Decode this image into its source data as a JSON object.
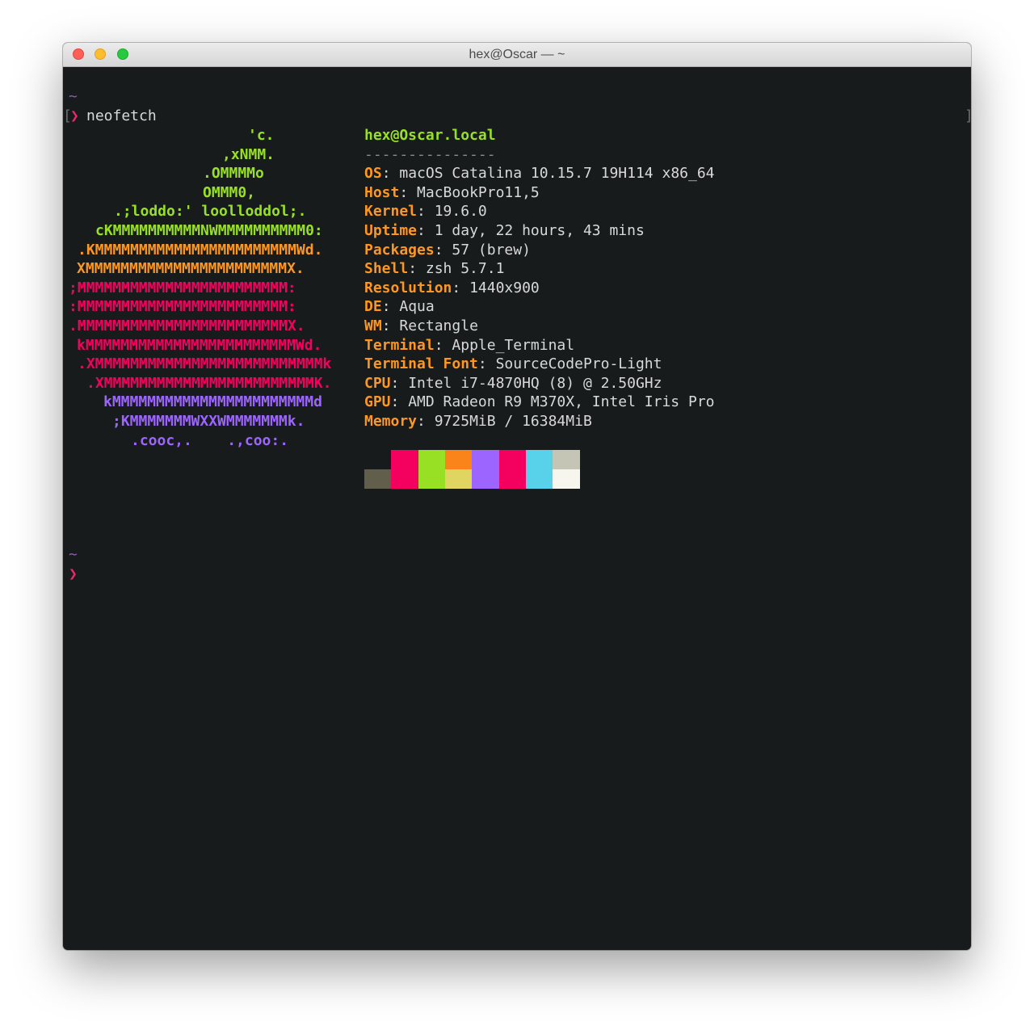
{
  "window": {
    "title": "hex@Oscar — ~"
  },
  "terminal": {
    "pre_prompt_tilde": "~",
    "left_bracket": "[",
    "right_bracket": "]",
    "prompt_symbol": "❯",
    "command": "neofetch",
    "bottom_tilde": "~",
    "bottom_prompt": "❯"
  },
  "logo": [
    {
      "text": "'c.",
      "color": "#98e024"
    },
    {
      "text": ",xNMM.",
      "color": "#98e024"
    },
    {
      "text": ".OMMMMo",
      "color": "#98e024"
    },
    {
      "text": "OMMM0,",
      "color": "#98e024"
    },
    {
      "text": ".;loddo:' loolloddol;.",
      "color": "#98e024"
    },
    {
      "text": "cKMMMMMMMMMMNWMMMMMMMMMM0:",
      "color": "#98e024"
    },
    {
      "text": ".KMMMMMMMMMMMMMMMMMMMMMMMWd.",
      "color": "#fd971f"
    },
    {
      "text": "XMMMMMMMMMMMMMMMMMMMMMMMX.",
      "color": "#fd971f"
    },
    {
      "text": ";MMMMMMMMMMMMMMMMMMMMMMMM:",
      "color": "#f4005f"
    },
    {
      "text": ":MMMMMMMMMMMMMMMMMMMMMMMM:",
      "color": "#f4005f"
    },
    {
      "text": ".MMMMMMMMMMMMMMMMMMMMMMMMX.",
      "color": "#f4005f"
    },
    {
      "text": "kMMMMMMMMMMMMMMMMMMMMMMMMWd.",
      "color": "#f4005f"
    },
    {
      "text": ".XMMMMMMMMMMMMMMMMMMMMMMMMMMk",
      "color": "#f4005f"
    },
    {
      "text": ".XMMMMMMMMMMMMMMMMMMMMMMMMK.",
      "color": "#f4005f"
    },
    {
      "text": "kMMMMMMMMMMMMMMMMMMMMMMMd",
      "color": "#9d65ff"
    },
    {
      "text": ";KMMMMMMMWXXWMMMMMMMk.",
      "color": "#9d65ff"
    },
    {
      "text": ".cooc,.    .,coo:.",
      "color": "#9d65ff"
    }
  ],
  "info": {
    "hostname": "hex@Oscar.local",
    "separator": "---------------",
    "rows": [
      {
        "key": "OS",
        "value": "macOS Catalina 10.15.7 19H114 x86_64"
      },
      {
        "key": "Host",
        "value": "MacBookPro11,5"
      },
      {
        "key": "Kernel",
        "value": "19.6.0"
      },
      {
        "key": "Uptime",
        "value": "1 day, 22 hours, 43 mins"
      },
      {
        "key": "Packages",
        "value": "57 (brew)"
      },
      {
        "key": "Shell",
        "value": "zsh 5.7.1"
      },
      {
        "key": "Resolution",
        "value": "1440x900"
      },
      {
        "key": "DE",
        "value": "Aqua"
      },
      {
        "key": "WM",
        "value": "Rectangle"
      },
      {
        "key": "Terminal",
        "value": "Apple_Terminal"
      },
      {
        "key": "Terminal Font",
        "value": "SourceCodePro-Light"
      },
      {
        "key": "CPU",
        "value": "Intel i7-4870HQ (8) @ 2.50GHz"
      },
      {
        "key": "GPU",
        "value": "AMD Radeon R9 M370X, Intel Iris Pro"
      },
      {
        "key": "Memory",
        "value": "9725MiB / 16384MiB"
      }
    ]
  },
  "palette": {
    "normal": [
      "#181b1c",
      "#f4005f",
      "#98e024",
      "#fa8419",
      "#9d65ff",
      "#f4005f",
      "#58d1eb",
      "#c4c5b5"
    ],
    "bright": [
      "#625e4c",
      "#f4005f",
      "#98e024",
      "#e0d561",
      "#9d65ff",
      "#f4005f",
      "#58d1eb",
      "#f6f6ef"
    ]
  }
}
